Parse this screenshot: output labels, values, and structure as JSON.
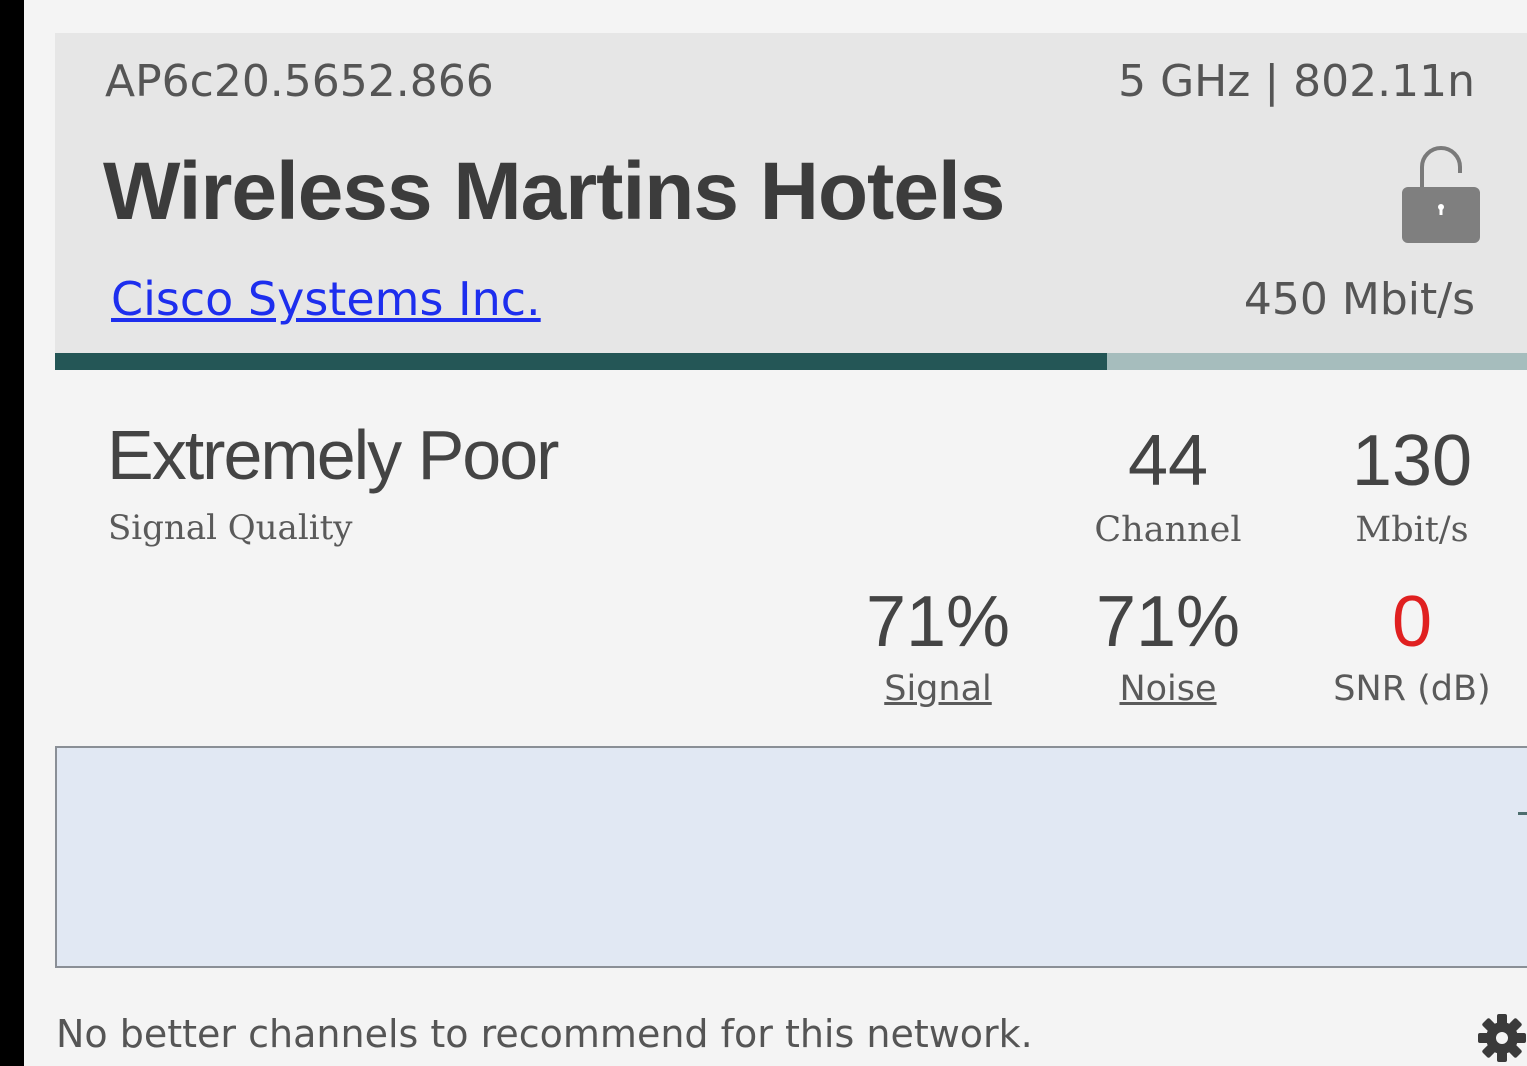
{
  "network": {
    "bssid": "AP6c20.5652.866",
    "band": "5 GHz | 802.11n",
    "ssid": "Wireless Martins Hotels",
    "vendor": "Cisco Systems Inc.",
    "max_rate": "450 Mbit/s",
    "security_icon": "lock-icon"
  },
  "quality": {
    "fraction": 0.715,
    "bar_color": "#245656",
    "bar_track_color": "#a6bdbd",
    "text": "Extremely Poor",
    "label": "Signal Quality"
  },
  "stats": {
    "channel": {
      "value": "44",
      "label": "Channel"
    },
    "rate": {
      "value": "130",
      "label": "Mbit/s"
    },
    "signal": {
      "value": "71%",
      "label": "Signal"
    },
    "noise": {
      "value": "71%",
      "label": "Noise"
    },
    "snr": {
      "value": "0",
      "label": "SNR (dB)",
      "color": "#e02020"
    }
  },
  "footer": {
    "message": "No better channels to recommend for this network.",
    "settings_icon": "gear-icon"
  }
}
